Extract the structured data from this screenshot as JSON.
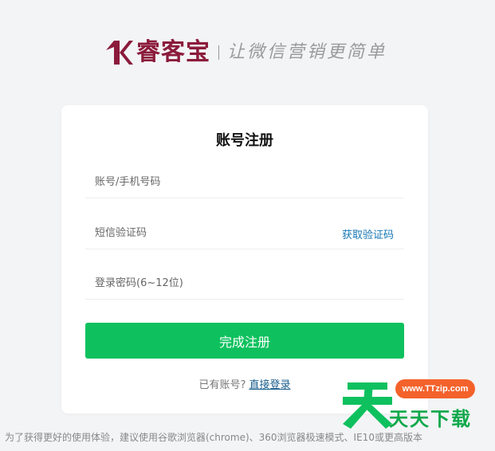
{
  "brand": {
    "name": "睿客宝",
    "slogan": "让微信营销更简单",
    "color": "#8b1b3b"
  },
  "form": {
    "title": "账号注册",
    "account_placeholder": "账号/手机号码",
    "sms_placeholder": "短信验证码",
    "get_code_label": "获取验证码",
    "password_placeholder": "登录密码(6~12位)",
    "submit_label": "完成注册",
    "has_account_text": "已有账号?",
    "login_link_label": "直接登录",
    "accent_color": "#0ec15e",
    "link_color": "#1677b3"
  },
  "footer": {
    "note": "为了获得更好的使用体验，建议使用谷歌浏览器(chrome)、360浏览器极速模式、IE10或更高版本"
  },
  "watermark": {
    "url": "www.TTzip.com",
    "text": "天天下载"
  }
}
